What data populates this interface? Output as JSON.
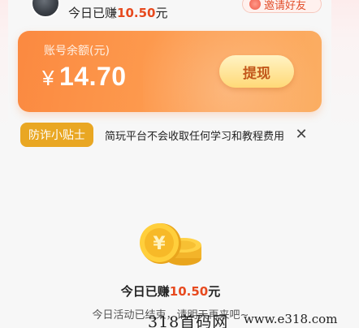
{
  "header": {
    "earned_prefix": "今日已赚",
    "earned_amount": "10.50",
    "earned_suffix": "元",
    "invite_label": "邀请好友"
  },
  "balance": {
    "label": "账号余额(元)",
    "currency": "¥",
    "amount": "14.70",
    "withdraw_label": "提现"
  },
  "tip": {
    "badge": "防诈小贴士",
    "text": "简玩平台不会收取任何学习和教程费用",
    "close_icon": "close-icon"
  },
  "empty_state": {
    "earned_prefix": "今日已赚",
    "earned_amount": "10.50",
    "earned_suffix": "元",
    "activity_text": "今日活动已结束，请明天再来吧~"
  },
  "watermark": {
    "left": "318首码网",
    "right": "www.e318.com"
  },
  "colors": {
    "accent_orange": "#fb8940",
    "amount_red": "#e74a1f",
    "tip_badge": "#e9a723",
    "withdraw_text": "#c2571b"
  }
}
